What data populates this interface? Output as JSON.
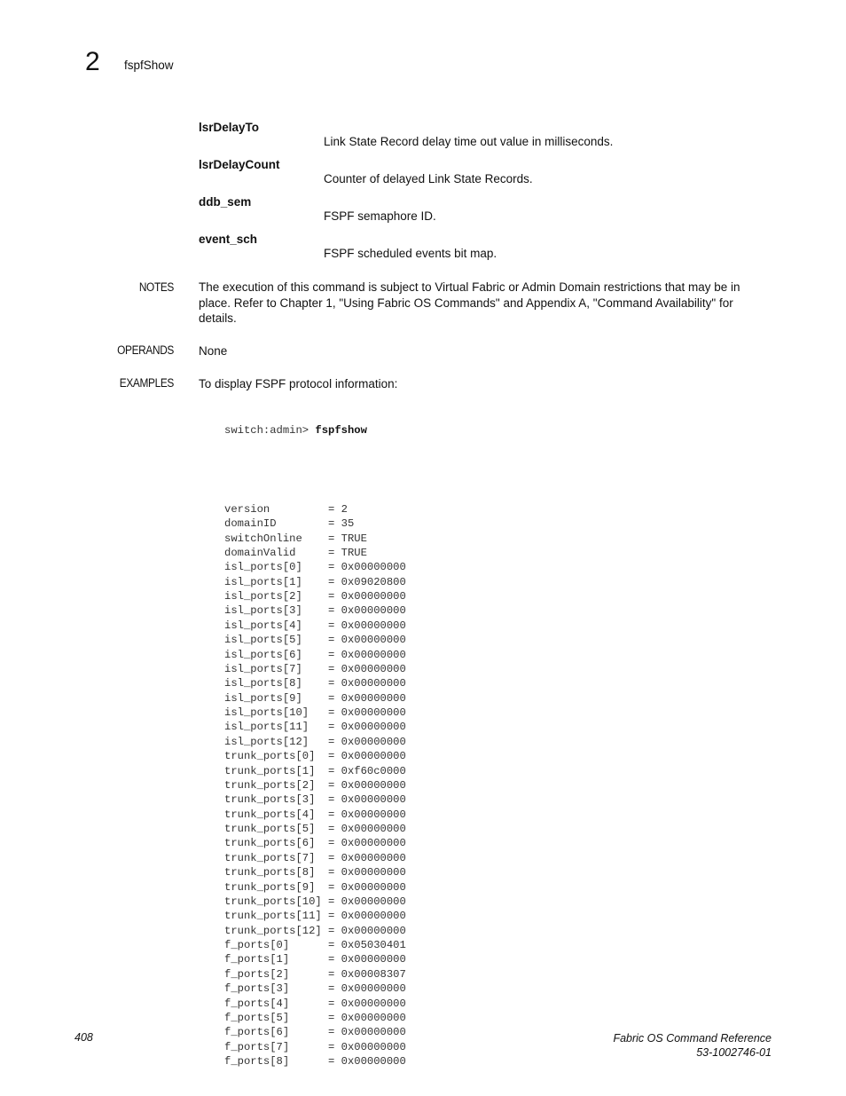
{
  "header": {
    "chapter_number": "2",
    "running_title": "fspfShow"
  },
  "parameters": [
    {
      "name": "lsrDelayTo",
      "description": "Link State Record delay time out value in milliseconds."
    },
    {
      "name": "lsrDelayCount",
      "description": "Counter of delayed Link State Records."
    },
    {
      "name": "ddb_sem",
      "description": "FSPF semaphore ID."
    },
    {
      "name": "event_sch",
      "description": "FSPF scheduled events bit map."
    }
  ],
  "sections": {
    "notes": {
      "label": "NOTES",
      "text": "The execution of this command is subject to Virtual Fabric or Admin Domain restrictions that may be in place. Refer to Chapter 1, \"Using Fabric OS Commands\" and Appendix A, \"Command Availability\" for details."
    },
    "operands": {
      "label": "OPERANDS",
      "text": "None"
    },
    "examples": {
      "label": "EXAMPLES",
      "text": "To display FSPF protocol information:"
    }
  },
  "example": {
    "prompt": "switch:admin> ",
    "command": "fspfshow",
    "output": [
      {
        "key": "version",
        "value": "2"
      },
      {
        "key": "domainID",
        "value": "35"
      },
      {
        "key": "switchOnline",
        "value": "TRUE"
      },
      {
        "key": "domainValid",
        "value": "TRUE"
      },
      {
        "key": "isl_ports[0]",
        "value": "0x00000000"
      },
      {
        "key": "isl_ports[1]",
        "value": "0x09020800"
      },
      {
        "key": "isl_ports[2]",
        "value": "0x00000000"
      },
      {
        "key": "isl_ports[3]",
        "value": "0x00000000"
      },
      {
        "key": "isl_ports[4]",
        "value": "0x00000000"
      },
      {
        "key": "isl_ports[5]",
        "value": "0x00000000"
      },
      {
        "key": "isl_ports[6]",
        "value": "0x00000000"
      },
      {
        "key": "isl_ports[7]",
        "value": "0x00000000"
      },
      {
        "key": "isl_ports[8]",
        "value": "0x00000000"
      },
      {
        "key": "isl_ports[9]",
        "value": "0x00000000"
      },
      {
        "key": "isl_ports[10]",
        "value": "0x00000000"
      },
      {
        "key": "isl_ports[11]",
        "value": "0x00000000"
      },
      {
        "key": "isl_ports[12]",
        "value": "0x00000000"
      },
      {
        "key": "trunk_ports[0]",
        "value": "0x00000000"
      },
      {
        "key": "trunk_ports[1]",
        "value": "0xf60c0000"
      },
      {
        "key": "trunk_ports[2]",
        "value": "0x00000000"
      },
      {
        "key": "trunk_ports[3]",
        "value": "0x00000000"
      },
      {
        "key": "trunk_ports[4]",
        "value": "0x00000000"
      },
      {
        "key": "trunk_ports[5]",
        "value": "0x00000000"
      },
      {
        "key": "trunk_ports[6]",
        "value": "0x00000000"
      },
      {
        "key": "trunk_ports[7]",
        "value": "0x00000000"
      },
      {
        "key": "trunk_ports[8]",
        "value": "0x00000000"
      },
      {
        "key": "trunk_ports[9]",
        "value": "0x00000000"
      },
      {
        "key": "trunk_ports[10]",
        "value": "0x00000000"
      },
      {
        "key": "trunk_ports[11]",
        "value": "0x00000000"
      },
      {
        "key": "trunk_ports[12]",
        "value": "0x00000000"
      },
      {
        "key": "f_ports[0]",
        "value": "0x05030401"
      },
      {
        "key": "f_ports[1]",
        "value": "0x00000000"
      },
      {
        "key": "f_ports[2]",
        "value": "0x00008307"
      },
      {
        "key": "f_ports[3]",
        "value": "0x00000000"
      },
      {
        "key": "f_ports[4]",
        "value": "0x00000000"
      },
      {
        "key": "f_ports[5]",
        "value": "0x00000000"
      },
      {
        "key": "f_ports[6]",
        "value": "0x00000000"
      },
      {
        "key": "f_ports[7]",
        "value": "0x00000000"
      },
      {
        "key": "f_ports[8]",
        "value": "0x00000000"
      }
    ]
  },
  "footer": {
    "page_number": "408",
    "book_title": "Fabric OS Command Reference",
    "doc_number": "53-1002746-01"
  }
}
